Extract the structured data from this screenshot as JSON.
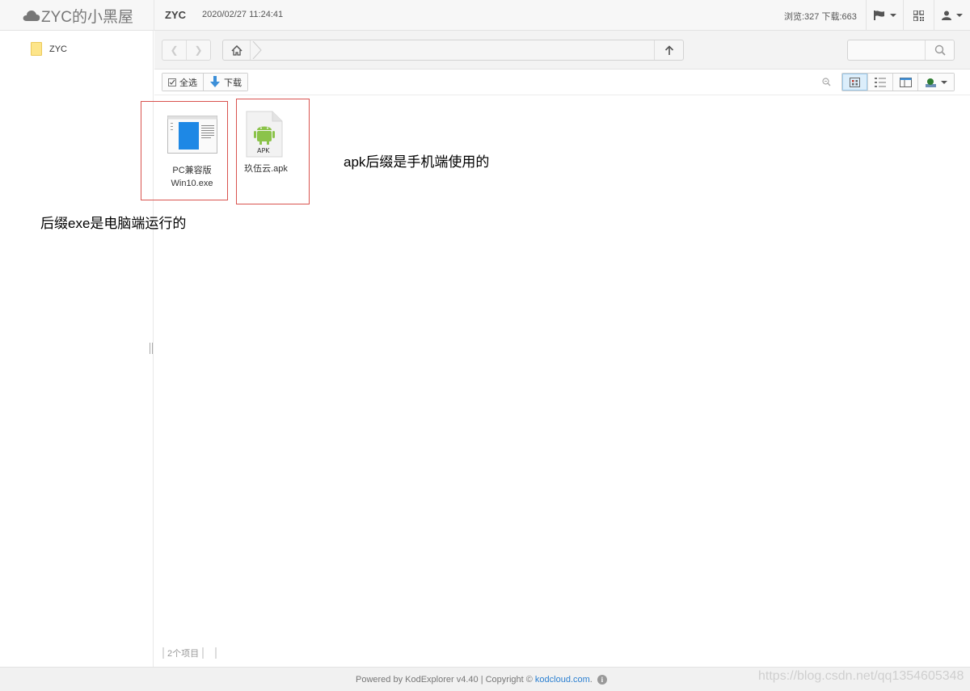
{
  "header": {
    "site_name": "ZYC的小黑屋",
    "share_title": "ZYC",
    "share_time": "2020/02/27 11:24:41",
    "stats": "浏览:327 下载:663",
    "icons": [
      "cloud-icon",
      "flag-icon",
      "qrcode-icon",
      "user-icon"
    ]
  },
  "sidebar": {
    "tree": [
      {
        "label": "ZYC",
        "icon": "folder-icon"
      }
    ]
  },
  "navbar": {
    "path": "",
    "search_placeholder": ""
  },
  "toolbar": {
    "select_all_label": "全选",
    "download_label": "下载",
    "active_view": "icon"
  },
  "files": [
    {
      "name": "PC兼容版Win10.exe",
      "type": "exe",
      "icon": "windows-app-icon"
    },
    {
      "name": "玖伍云.apk",
      "type": "apk",
      "icon": "android-apk-icon",
      "badge": "APK"
    }
  ],
  "annotations": {
    "apk_note": "apk后缀是手机端使用的",
    "exe_note": "后缀exe是电脑端运行的"
  },
  "status": {
    "count_text": "2个项目"
  },
  "footer": {
    "powered": "Powered by KodExplorer v4.40 | Copyright © ",
    "link": "kodcloud.com",
    "suffix": ".",
    "watermark": "https://blog.csdn.net/qq1354605348"
  },
  "colors": {
    "annotation_box": "#d9534f",
    "link": "#2a7fd1",
    "folder": "#fde58a"
  }
}
